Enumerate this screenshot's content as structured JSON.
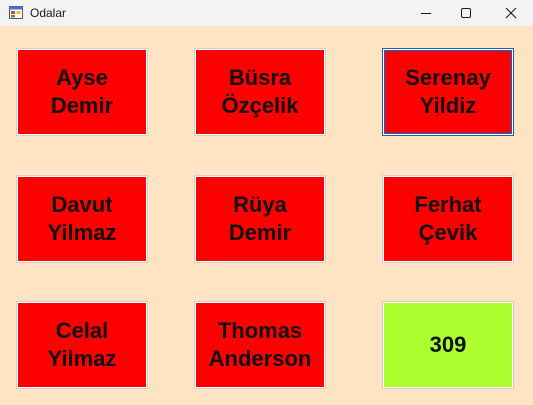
{
  "window": {
    "title": "Odalar",
    "background": "#ffe4c4"
  },
  "colors": {
    "occupied": "#ff0000",
    "available": "#adff2f"
  },
  "rooms": [
    {
      "label": "Ayse\nDemir",
      "status": "occupied"
    },
    {
      "label": "Büsra\nÖzçelik",
      "status": "occupied"
    },
    {
      "label": "Serenay\nYildiz",
      "status": "occupied",
      "focused": true
    },
    {
      "label": "Davut\nYilmaz",
      "status": "occupied"
    },
    {
      "label": "Rüya\nDemir",
      "status": "occupied"
    },
    {
      "label": "Ferhat\nÇevik",
      "status": "occupied"
    },
    {
      "label": "Celal\nYilmaz",
      "status": "occupied"
    },
    {
      "label": "Thomas\nAnderson",
      "status": "occupied"
    },
    {
      "label": "309",
      "status": "available"
    }
  ],
  "icons": {
    "app": "app-window-icon",
    "minimize": "minimize-icon",
    "maximize": "maximize-icon",
    "close": "close-icon"
  }
}
